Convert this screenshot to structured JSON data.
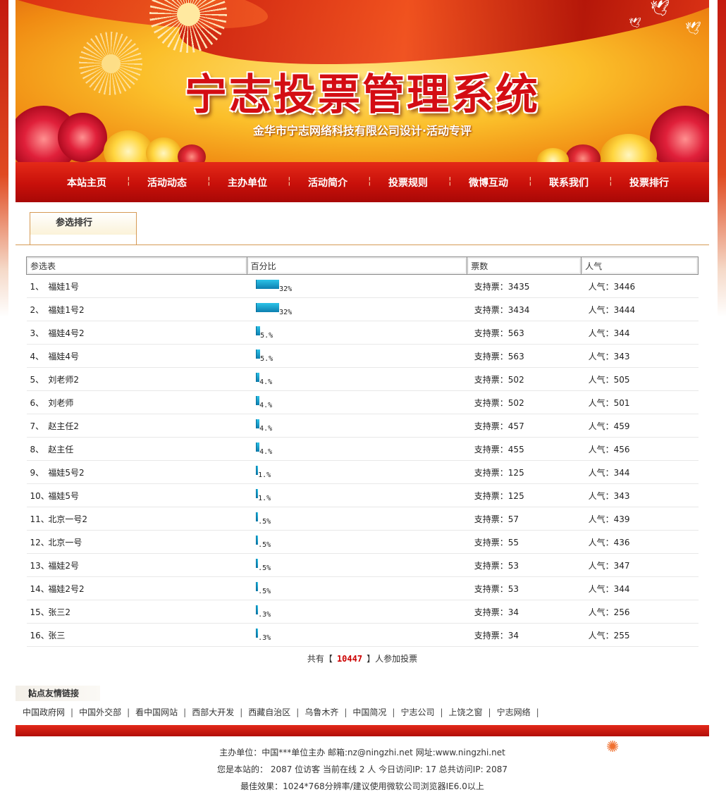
{
  "banner": {
    "title": "宁志投票管理系统",
    "subtitle": "金华市宁志网络科技有限公司设计·活动专评"
  },
  "nav": [
    "本站主页",
    "活动动态",
    "主办单位",
    "活动简介",
    "投票规则",
    "微博互动",
    "联系我们",
    "投票排行"
  ],
  "tab": {
    "label": "参选排行"
  },
  "table": {
    "headers": [
      "参选表",
      "百分比",
      "票数",
      "人气"
    ],
    "rows": [
      {
        "no": "1、",
        "name": "福娃1号",
        "pct_label": "32%",
        "pct": 32,
        "votes": "支持票：3435",
        "pop": "人气：3446"
      },
      {
        "no": "2、",
        "name": "福娃1号2",
        "pct_label": "32%",
        "pct": 32,
        "votes": "支持票：3434",
        "pop": "人气：3444"
      },
      {
        "no": "3、",
        "name": "福娃4号2",
        "pct_label": "5.%",
        "pct": 5,
        "votes": "支持票：563",
        "pop": "人气：344"
      },
      {
        "no": "4、",
        "name": "福娃4号",
        "pct_label": "5.%",
        "pct": 5,
        "votes": "支持票：563",
        "pop": "人气：343"
      },
      {
        "no": "5、",
        "name": "刘老师2",
        "pct_label": "4.%",
        "pct": 4,
        "votes": "支持票：502",
        "pop": "人气：505"
      },
      {
        "no": "6、",
        "name": "刘老师",
        "pct_label": "4.%",
        "pct": 4,
        "votes": "支持票：502",
        "pop": "人气：501"
      },
      {
        "no": "7、",
        "name": "赵主任2",
        "pct_label": "4.%",
        "pct": 4,
        "votes": "支持票：457",
        "pop": "人气：459"
      },
      {
        "no": "8、",
        "name": "赵主任",
        "pct_label": "4.%",
        "pct": 4,
        "votes": "支持票：455",
        "pop": "人气：456"
      },
      {
        "no": "9、",
        "name": "福娃5号2",
        "pct_label": "1.%",
        "pct": 1,
        "votes": "支持票：125",
        "pop": "人气：344"
      },
      {
        "no": "10、",
        "name": "福娃5号",
        "pct_label": "1.%",
        "pct": 1,
        "votes": "支持票：125",
        "pop": "人气：343"
      },
      {
        "no": "11、",
        "name": "北京一号2",
        "pct_label": ".5%",
        "pct": 0.5,
        "votes": "支持票：57",
        "pop": "人气：439"
      },
      {
        "no": "12、",
        "name": "北京一号",
        "pct_label": ".5%",
        "pct": 0.5,
        "votes": "支持票：55",
        "pop": "人气：436"
      },
      {
        "no": "13、",
        "name": "福娃2号",
        "pct_label": ".5%",
        "pct": 0.5,
        "votes": "支持票：53",
        "pop": "人气：347"
      },
      {
        "no": "14、",
        "name": "福娃2号2",
        "pct_label": ".5%",
        "pct": 0.5,
        "votes": "支持票：53",
        "pop": "人气：344"
      },
      {
        "no": "15、",
        "name": "张三2",
        "pct_label": ".3%",
        "pct": 0.3,
        "votes": "支持票：34",
        "pop": "人气：256"
      },
      {
        "no": "16、",
        "name": "张三",
        "pct_label": ".3%",
        "pct": 0.3,
        "votes": "支持票：34",
        "pop": "人气：255"
      }
    ]
  },
  "total": {
    "prefix": "共有【",
    "count": "10447",
    "suffix": "】人参加投票"
  },
  "friend_links": {
    "title": "站点友情链接",
    "items": [
      "中国政府网",
      "中国外交部",
      "看中国网站",
      "西部大开发",
      "西藏自治区",
      "乌鲁木齐",
      "中国简况",
      "宁志公司",
      "上饶之窗",
      "宁志网络"
    ]
  },
  "footer": {
    "line1": "主办单位：中国***单位主办 邮箱:nz@ningzhi.net 网址:www.ningzhi.net",
    "line2": "您是本站的：  2087 位访客  当前在线 2 人 今日访问IP:  17  总共访问IP:  2087",
    "line3": "最佳效果：1024*768分辨率/建议使用微软公司浏览器IE6.0以上"
  },
  "colors": {
    "nav_red": "#c8100a",
    "total_red": "#cc0000",
    "bar_blue": "#1aa0d0"
  }
}
